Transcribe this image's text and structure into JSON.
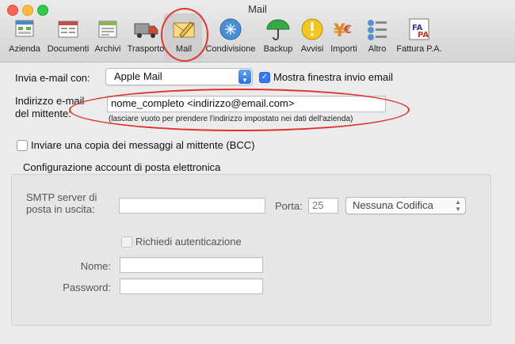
{
  "window": {
    "title": "Mail"
  },
  "toolbar": {
    "items": [
      {
        "label": "Azienda",
        "icon": "company-icon"
      },
      {
        "label": "Documenti",
        "icon": "documents-icon"
      },
      {
        "label": "Archivi",
        "icon": "archive-icon"
      },
      {
        "label": "Trasporto",
        "icon": "truck-icon"
      },
      {
        "label": "Mail",
        "icon": "mail-icon",
        "selected": true
      },
      {
        "label": "Condivisione",
        "icon": "sharing-icon"
      },
      {
        "label": "Backup",
        "icon": "umbrella-icon"
      },
      {
        "label": "Avvisi",
        "icon": "alert-icon"
      },
      {
        "label": "Importi",
        "icon": "currency-icon"
      },
      {
        "label": "Altro",
        "icon": "other-icon"
      },
      {
        "label": "Fattura P.A.",
        "icon": "fattura-pa-icon"
      }
    ]
  },
  "send": {
    "label": "Invia e-mail con:",
    "client_value": "Apple Mail",
    "show_window_label": "Mostra finestra invio email",
    "show_window_checked": true
  },
  "sender": {
    "label_line1": "Indirizzo e-mail",
    "label_line2": "del mittente:",
    "value": "nome_completo <indirizzo@email.com>",
    "hint": "(lasciare vuoto per prendere l'indirizzo impostato nei dati dell'azienda)"
  },
  "bcc": {
    "label": "Inviare una copia dei messaggi al mittente (BCC)",
    "checked": false
  },
  "account": {
    "heading": "Configurazione account di posta elettronica",
    "smtp_label_line1": "SMTP server di",
    "smtp_label_line2": "posta in uscita:",
    "smtp_value": "",
    "port_label": "Porta:",
    "port_value": "25",
    "encoding_value": "Nessuna Codifica",
    "auth_label": "Richiedi autenticazione",
    "auth_checked": false,
    "name_label": "Nome:",
    "name_value": "",
    "password_label": "Password:",
    "password_value": ""
  },
  "colors": {
    "accent": "#3478f6",
    "annotation": "#e0332e"
  }
}
